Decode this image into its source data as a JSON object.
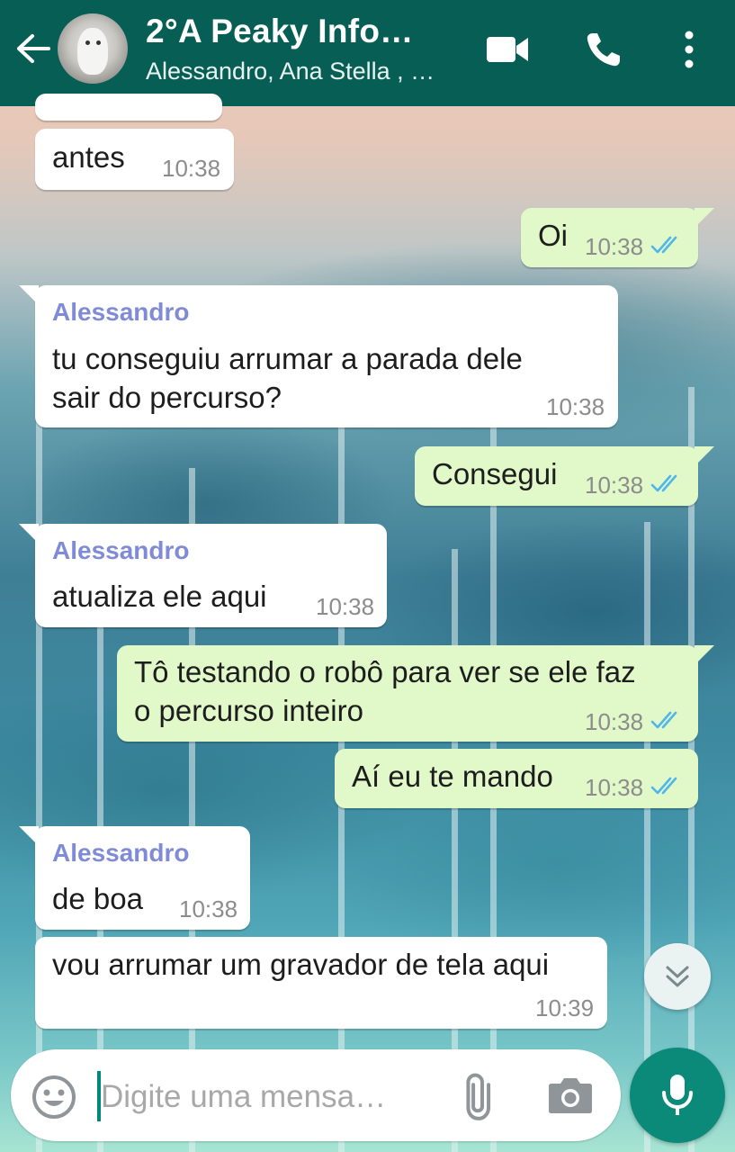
{
  "header": {
    "title": "2°A Peaky Info…",
    "subtitle": "Alessandro, Ana Stella , …"
  },
  "messages": [
    {
      "direction": "in",
      "sender": "",
      "text": [
        "antes"
      ],
      "time": "10:38"
    },
    {
      "direction": "out",
      "sender": "",
      "text": [
        "Oi"
      ],
      "time": "10:38",
      "read": true
    },
    {
      "direction": "in",
      "sender": "Alessandro",
      "text": [
        "tu conseguiu arrumar a parada dele",
        "sair do percurso?"
      ],
      "time": "10:38"
    },
    {
      "direction": "out",
      "sender": "",
      "text": [
        "Consegui"
      ],
      "time": "10:38",
      "read": true
    },
    {
      "direction": "in",
      "sender": "Alessandro",
      "text": [
        "atualiza ele aqui"
      ],
      "time": "10:38"
    },
    {
      "direction": "out",
      "sender": "",
      "text": [
        "Tô testando o robô para ver se ele faz",
        "o percurso inteiro"
      ],
      "time": "10:38",
      "read": true
    },
    {
      "direction": "out",
      "sender": "",
      "text": [
        "Aí eu te mando"
      ],
      "time": "10:38",
      "read": true
    },
    {
      "direction": "in",
      "sender": "Alessandro",
      "text": [
        "de boa"
      ],
      "time": "10:38"
    },
    {
      "direction": "in",
      "sender": "",
      "text": [
        "vou arrumar um gravador de tela aqui"
      ],
      "time": "10:39"
    }
  ],
  "composer": {
    "placeholder": "Digite uma mensa…"
  },
  "icons": {
    "back": "arrow-left-icon",
    "video": "video-camera-icon",
    "call": "phone-icon",
    "menu": "more-vertical-icon",
    "emoji": "emoji-icon",
    "attach": "paperclip-icon",
    "camera": "camera-icon",
    "mic": "microphone-icon",
    "scroll": "double-chevron-down-icon",
    "read_receipt": "double-check-icon"
  },
  "colors": {
    "header": "#075e54",
    "outgoing_bubble": "#e1f8c9",
    "incoming_bubble": "#ffffff",
    "sender_name": "#7f8bd6",
    "read_ticks": "#4fb6ec",
    "mic_button": "#0b8a7a"
  }
}
